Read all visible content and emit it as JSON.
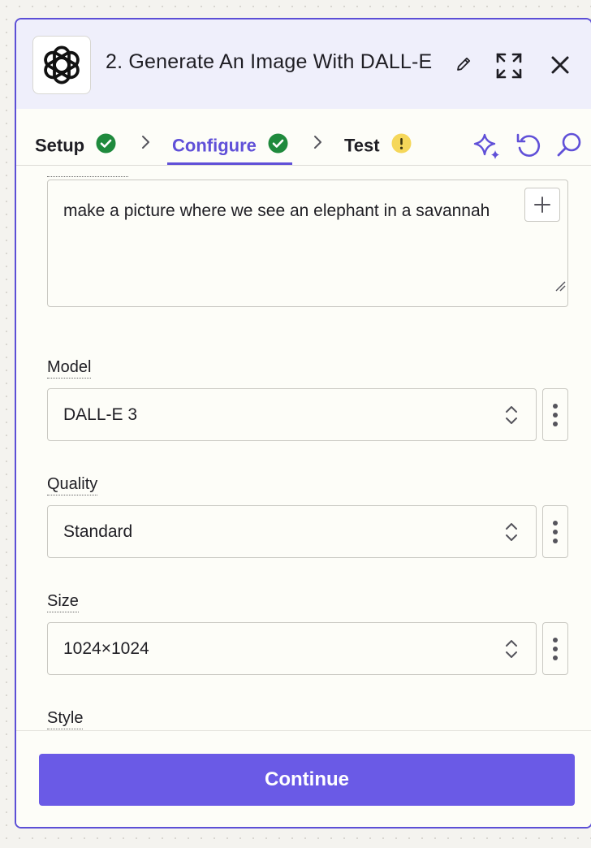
{
  "header": {
    "title": "2. Generate An Image With DALL-E",
    "app_icon": "openai-logo-icon"
  },
  "tabs": [
    {
      "label": "Setup",
      "status": "complete",
      "status_icon": "check-circle-icon"
    },
    {
      "label": "Configure",
      "status": "complete",
      "status_icon": "check-circle-icon",
      "active": true
    },
    {
      "label": "Test",
      "status": "warning",
      "status_icon": "warning-circle-icon"
    }
  ],
  "toolbar_icons": [
    "sparkles-icon",
    "undo-icon",
    "search-icon"
  ],
  "prompt": {
    "value": "make a picture where we see an elephant in a savannah"
  },
  "fields": [
    {
      "label": "Model",
      "value": "DALL-E 3"
    },
    {
      "label": "Quality",
      "value": "Standard"
    },
    {
      "label": "Size",
      "value": "1024×1024"
    },
    {
      "label": "Style",
      "value": ""
    }
  ],
  "footer": {
    "continue_label": "Continue"
  },
  "colors": {
    "accent": "#6a5ae6",
    "accent_text": "#6050d8",
    "success": "#1f8a3d",
    "warning": "#f5d75a",
    "header_bg": "#efeffb"
  }
}
